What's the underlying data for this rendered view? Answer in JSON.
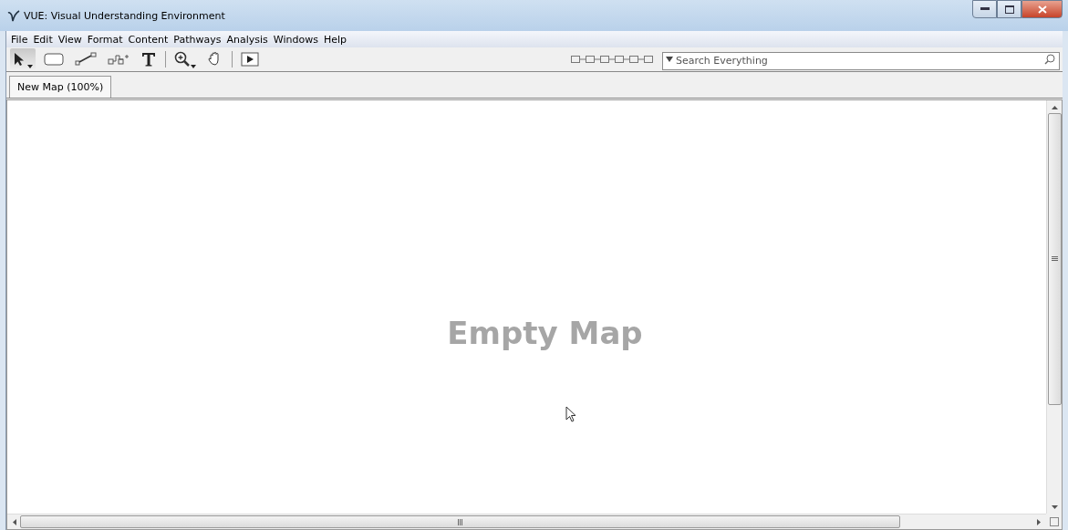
{
  "window": {
    "title": "VUE: Visual Understanding Environment"
  },
  "menu": [
    "File",
    "Edit",
    "View",
    "Format",
    "Content",
    "Pathways",
    "Analysis",
    "Windows",
    "Help"
  ],
  "tools": [
    {
      "kind": "select",
      "selected": true,
      "dropdown": true
    },
    {
      "kind": "node",
      "selected": false,
      "dropdown": false
    },
    {
      "kind": "link",
      "selected": false,
      "dropdown": false
    },
    {
      "kind": "combo",
      "selected": false,
      "dropdown": false
    },
    {
      "kind": "text",
      "selected": false,
      "dropdown": false
    },
    {
      "kind": "separator"
    },
    {
      "kind": "zoom",
      "selected": false,
      "dropdown": true
    },
    {
      "kind": "hand",
      "selected": false,
      "dropdown": false
    },
    {
      "kind": "separator"
    },
    {
      "kind": "present",
      "selected": false,
      "dropdown": false
    }
  ],
  "search": {
    "placeholder": "Search Everything"
  },
  "tabs": [
    {
      "label": "New Map (100%)",
      "selected": true
    }
  ],
  "canvas": {
    "message": "Empty Map"
  }
}
